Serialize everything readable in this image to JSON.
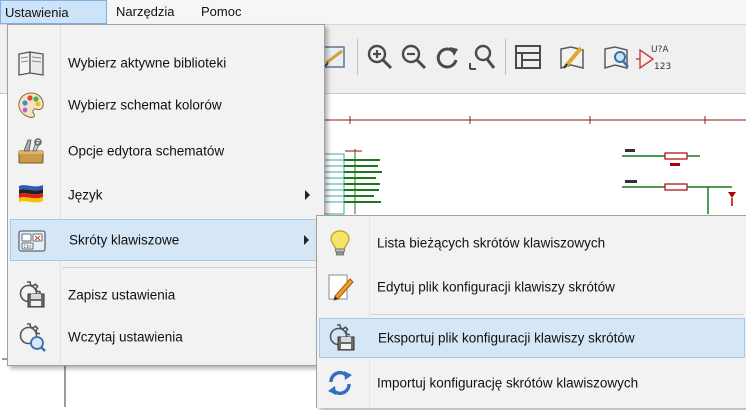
{
  "menubar": {
    "items": [
      {
        "label": "Ustawienia"
      },
      {
        "label": "Narzędzia"
      },
      {
        "label": "Pomoc"
      }
    ]
  },
  "settings_menu": {
    "items": [
      {
        "label": "Wybierz aktywne biblioteki",
        "icon": "library-book-icon"
      },
      {
        "label": "Wybierz schemat kolorów",
        "icon": "color-palette-icon"
      },
      {
        "label": "Opcje edytora schematów",
        "icon": "editor-options-icon"
      },
      {
        "label": "Język",
        "icon": "language-flag-icon",
        "has_submenu": true
      },
      {
        "label": "Skróty klawiszowe",
        "icon": "hotkeys-icon",
        "has_submenu": true,
        "highlighted": true
      },
      {
        "label": "Zapisz ustawienia",
        "icon": "save-settings-icon"
      },
      {
        "label": "Wczytaj ustawienia",
        "icon": "load-settings-icon"
      }
    ]
  },
  "hotkeys_submenu": {
    "items": [
      {
        "label": "Lista bieżących skrótów klawiszowych",
        "icon": "lightbulb-icon"
      },
      {
        "label": "Edytuj plik konfiguracji klawiszy skrótów",
        "icon": "edit-pencil-icon"
      },
      {
        "label": "Eksportuj plik konfiguracji klawiszy skrótów",
        "icon": "export-config-icon",
        "highlighted": true
      },
      {
        "label": "Importuj konfigurację skrótów klawiszowych",
        "icon": "import-config-icon"
      }
    ]
  },
  "toolbar": {
    "symbol_ref_label": "U?A",
    "symbol_num_label": "123"
  },
  "colors": {
    "highlight": "#d5e6f7",
    "highlight_border": "#a7c8ea",
    "schematic_wire": "#008000",
    "schematic_part": "#b00000",
    "schematic_pin": "#3fa7a0"
  }
}
